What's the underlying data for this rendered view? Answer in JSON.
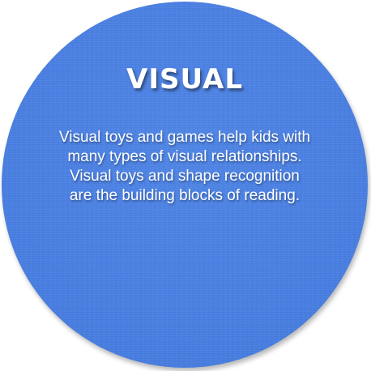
{
  "card": {
    "title": "VISUAL",
    "body_lines": [
      "Visual toys and games help kids with",
      "many types of visual relationships.",
      "Visual toys and shape recognition",
      "are the building blocks of reading."
    ],
    "colors": {
      "circle": "#4a80e4",
      "text": "#ffffff",
      "background": "#ffffff"
    }
  }
}
